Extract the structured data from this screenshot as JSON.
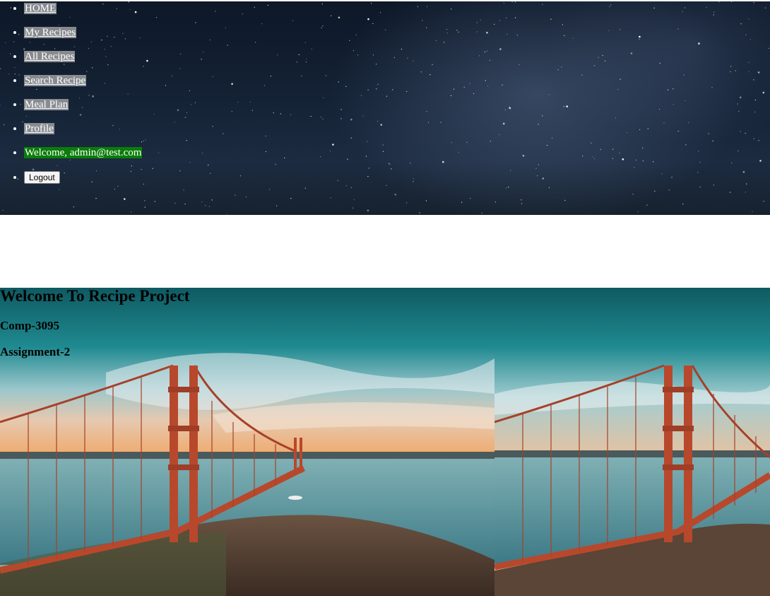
{
  "nav": {
    "items": [
      {
        "label": "HOME"
      },
      {
        "label": "My Recipes"
      },
      {
        "label": "All Recipes"
      },
      {
        "label": "Search Recipe"
      },
      {
        "label": "Meal Plan"
      },
      {
        "label": "Profile"
      }
    ],
    "welcome": "Welcome, admin@test.com",
    "logout": "Logout"
  },
  "hero": {
    "title": "Welcome To Recipe Project",
    "course": "Comp-3095",
    "assignment": "Assignment-2"
  },
  "colors": {
    "welcome_bg": "#0a7d0a",
    "sky": "#142235",
    "bridge": "#b8482c",
    "water": "#4f8f9a",
    "sky_teal": "#1f8a90"
  },
  "icons": {
    "header_background": "starfield-image",
    "hero_background": "golden-gate-bridge-image"
  }
}
